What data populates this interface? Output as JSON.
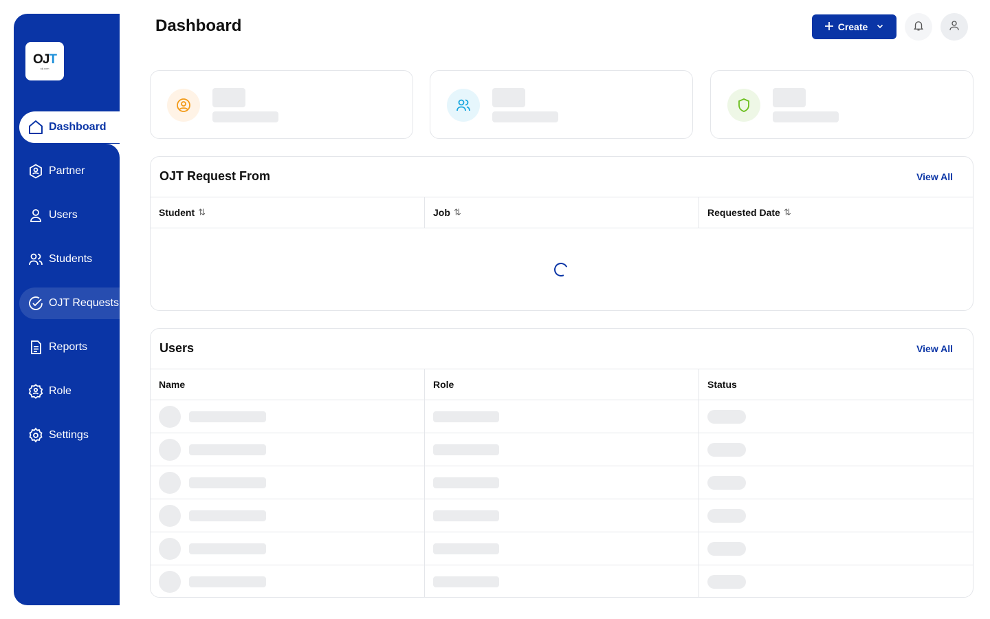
{
  "app": {
    "logo_text": "OJT",
    "logo_sub": "ojt.com"
  },
  "sidebar": {
    "items": [
      {
        "label": "Dashboard",
        "icon": "home-icon",
        "active": true
      },
      {
        "label": "Partner",
        "icon": "partner-icon"
      },
      {
        "label": "Users",
        "icon": "user-icon"
      },
      {
        "label": "Students",
        "icon": "users-icon"
      },
      {
        "label": "OJT Requests",
        "icon": "check-circle-icon"
      },
      {
        "label": "Reports",
        "icon": "document-icon"
      },
      {
        "label": "Role",
        "icon": "role-icon"
      },
      {
        "label": "Settings",
        "icon": "gear-icon"
      }
    ]
  },
  "header": {
    "title": "Dashboard",
    "create_label": "Create"
  },
  "requests": {
    "title": "OJT Request From",
    "view_all": "View All",
    "columns": [
      "Student",
      "Job",
      "Requested Date"
    ]
  },
  "users": {
    "title": "Users",
    "view_all": "View All",
    "columns": [
      "Name",
      "Role",
      "Status"
    ]
  },
  "colors": {
    "primary": "#0a35a6",
    "card_orange": "#fff3e6",
    "card_blue": "#e6f6fc",
    "card_green": "#eef7e6"
  }
}
